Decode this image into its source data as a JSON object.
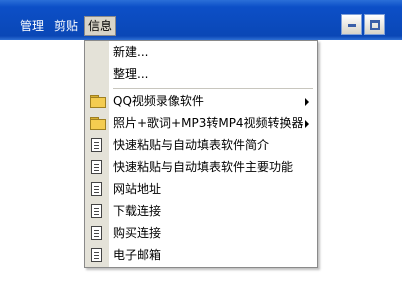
{
  "menubar": {
    "items": [
      "管理",
      "剪贴",
      "信息"
    ]
  },
  "dropdown": {
    "items": [
      {
        "label": "新建...",
        "icon": "none"
      },
      {
        "label": "整理...",
        "icon": "none"
      },
      {
        "label": "QQ视频录像软件",
        "icon": "folder-icon",
        "submenu": true
      },
      {
        "label": "照片+歌词+MP3转MP4视频转换器",
        "icon": "folder-icon",
        "submenu": true
      },
      {
        "label": "快速粘贴与自动填表软件简介",
        "icon": "document-icon"
      },
      {
        "label": "快速粘贴与自动填表软件主要功能",
        "icon": "document-icon"
      },
      {
        "label": "网站地址",
        "icon": "document-icon"
      },
      {
        "label": "下载连接",
        "icon": "document-icon"
      },
      {
        "label": "购买连接",
        "icon": "document-icon"
      },
      {
        "label": "电子邮箱",
        "icon": "document-icon"
      }
    ]
  },
  "colors": {
    "menubar": "#0a47b6",
    "menu_gutter": "#e4e2d8",
    "folder": "#f4cc50"
  }
}
